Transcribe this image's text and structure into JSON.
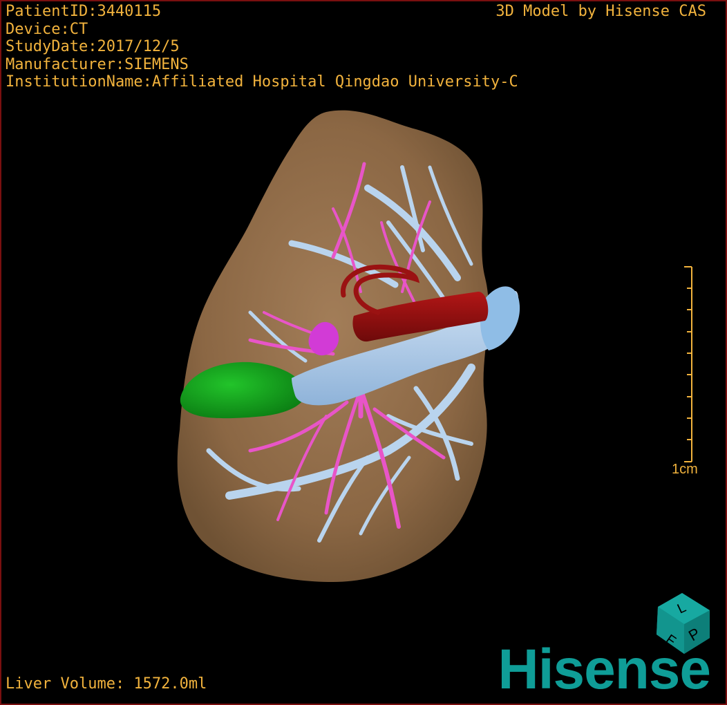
{
  "overlay": {
    "patient_id": "PatientID:3440115",
    "device": "Device:CT",
    "study_date": "StudyDate:2017/12/5",
    "manufacturer": "Manufacturer:SIEMENS",
    "institution": "InstitutionName:Affiliated Hospital Qingdao University-C",
    "model_credit": "3D Model by Hisense CAS",
    "liver_volume": "Liver Volume: 1572.0ml",
    "scale_label": "1cm"
  },
  "orientation_cube": {
    "faces": [
      "L",
      "P",
      "F"
    ]
  },
  "logo": {
    "text": "Hisense"
  },
  "colors": {
    "overlay_text": "#f2b33d",
    "liver": "#8e6a47",
    "portal_vein": "#b9d4ee",
    "hepatic_artery": "#e855c8",
    "inferior_vena_cava": "#8d1010",
    "tumor": "#0c9e16",
    "brand": "#0f9d97"
  }
}
